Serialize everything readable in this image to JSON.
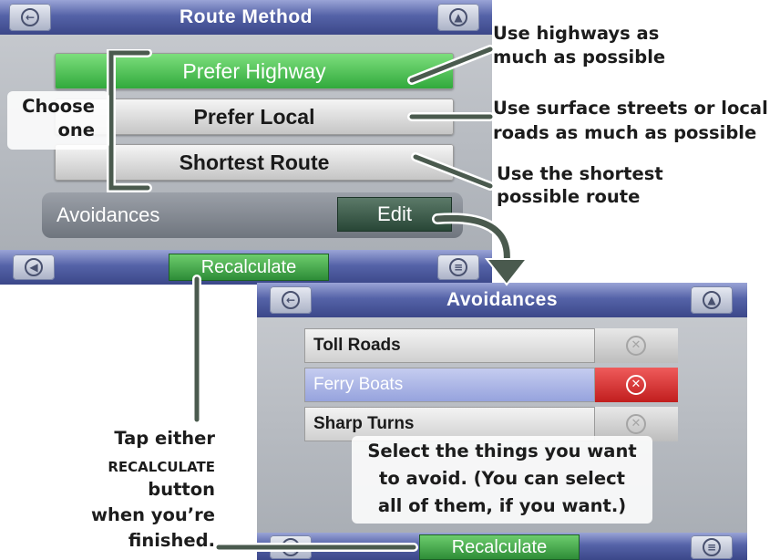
{
  "top_screen": {
    "title": "Route Method",
    "options": [
      {
        "label": "Prefer Highway",
        "active": true
      },
      {
        "label": "Prefer Local",
        "active": false
      },
      {
        "label": "Shortest Route",
        "active": false
      }
    ],
    "avoidances_label": "Avoidances",
    "edit_label": "Edit",
    "recalculate_label": "Recalculate"
  },
  "bottom_screen": {
    "title": "Avoidances",
    "items": [
      {
        "label": "Toll Roads",
        "selected": false
      },
      {
        "label": "Ferry Boats",
        "selected": true
      },
      {
        "label": "Sharp Turns",
        "selected": false
      }
    ],
    "recalculate_label": "Recalculate"
  },
  "callouts": {
    "choose_line1": "Choose",
    "choose_line2": "one",
    "highway_line1": "Use highways as",
    "highway_line2": "much as possible",
    "local_line1": "Use surface streets or local",
    "local_line2": "roads as much as possible",
    "shortest_line1": "Use the shortest",
    "shortest_line2": "possible route",
    "select_line1": "Select the things you want",
    "select_line2": "to avoid. (You can select",
    "select_line3": "all of them, if you want.)",
    "tap_line1": "Tap either",
    "tap_line2": "RECALCULATE",
    "tap_line3": "button",
    "tap_line4": "when you’re",
    "tap_line5": "finished."
  },
  "icons": [
    "back-arrow-icon",
    "navigation-icon",
    "volume-icon",
    "menu-icon",
    "close-x-icon"
  ],
  "colors": {
    "active_green": "#2fa83a",
    "title_bar": "#4a57a0",
    "avoid_red": "#c11e1e",
    "connector": "#4a5a4e"
  }
}
